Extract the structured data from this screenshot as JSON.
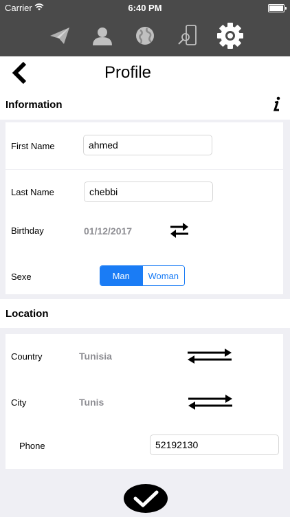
{
  "status_bar": {
    "carrier": "Carrier",
    "time": "6:40 PM"
  },
  "tab_bar": {
    "icons": [
      "paper-plane-icon",
      "user-icon",
      "globe-icon",
      "phone-search-icon",
      "settings-icon"
    ]
  },
  "nav": {
    "title": "Profile"
  },
  "information": {
    "header": "Information",
    "first_name_label": "First Name",
    "first_name_value": "ahmed",
    "last_name_label": "Last Name",
    "last_name_value": "chebbi",
    "birthday_label": "Birthday",
    "birthday_value": "01/12/2017",
    "sexe_label": "Sexe",
    "sexe_options": [
      "Man",
      "Woman"
    ],
    "sexe_selected": "Man"
  },
  "location": {
    "header": "Location",
    "country_label": "Country",
    "country_value": "Tunisia",
    "city_label": "City",
    "city_value": "Tunis",
    "phone_label": "Phone",
    "phone_value": "52192130"
  },
  "colors": {
    "bar_bg": "#4a4a4a",
    "accent": "#1a7cf5",
    "grey_text": "#8e8e93",
    "page_bg": "#efeff4"
  }
}
